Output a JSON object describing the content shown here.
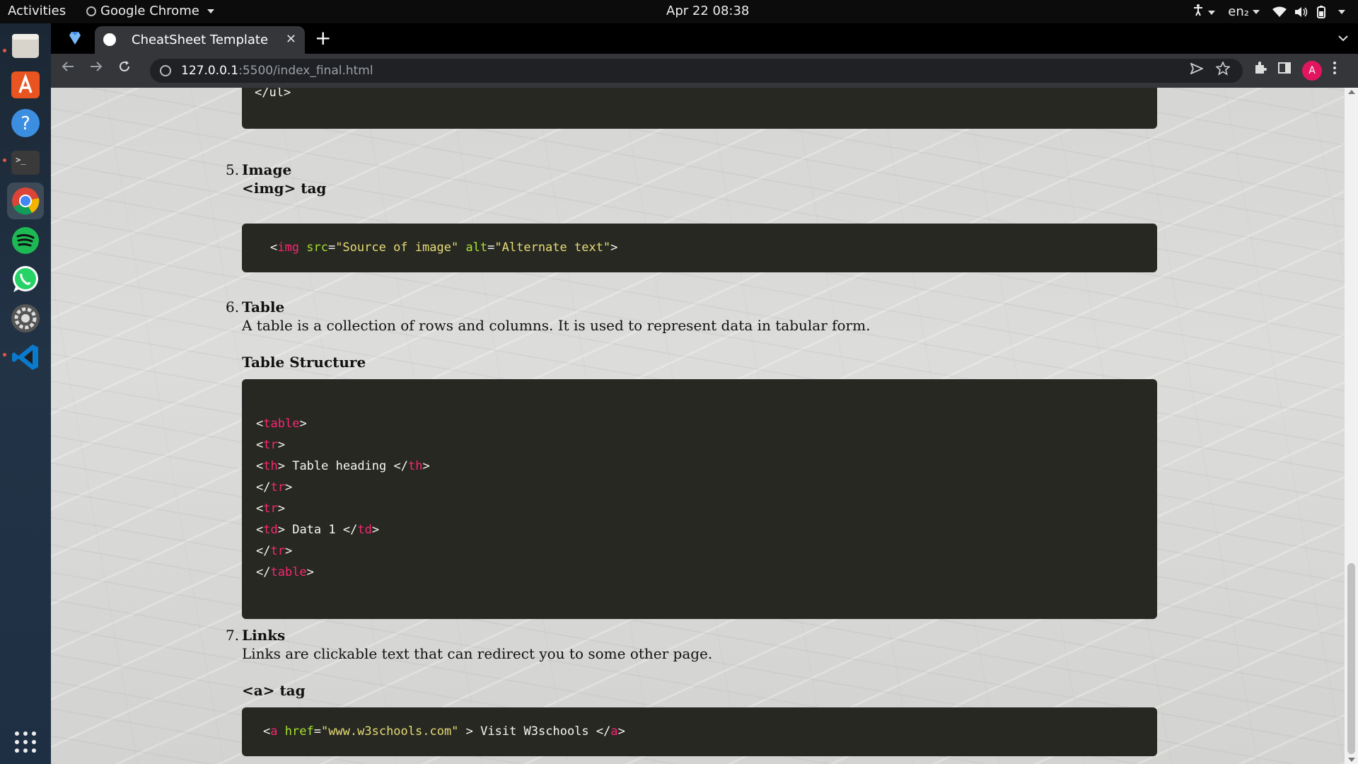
{
  "topbar": {
    "activities": "Activities",
    "app_name": "Google Chrome",
    "clock": "Apr 22  08:38",
    "lang": "en₂"
  },
  "dock": {
    "items": [
      "files-icon",
      "software-icon",
      "help-icon",
      "terminal-icon",
      "chrome-icon",
      "spotify-icon",
      "whatsapp-icon",
      "settings-icon",
      "vscode-icon"
    ],
    "apps_grid": "apps-grid-icon"
  },
  "browser": {
    "tab_title": "CheatSheet Template",
    "close_glyph": "✕",
    "new_tab_glyph": "+",
    "url_host": "127.0.0.1",
    "url_path": ":5500/index_final.html",
    "avatar_letter": "A"
  },
  "page": {
    "prev_code_tail": "</ul>",
    "sections": [
      {
        "num": "5.",
        "title": "Image",
        "subtitle": "<img> tag",
        "code": {
          "open": "<",
          "tag": "img",
          "attr1": "src",
          "eq1": "=",
          "val1": "\"Source of image\"",
          "attr2": "alt",
          "eq2": "=",
          "val2": "\"Alternate text\"",
          "close": ">"
        }
      },
      {
        "num": "6.",
        "title": "Table",
        "text": "A table is a collection of rows and columns. It is used to represent data in tabular form.",
        "subtitle": "Table Structure",
        "code_lines": [
          {
            "pre": "<",
            "tag": "table",
            "mid": "",
            "tag2": "",
            "post": ">"
          },
          {
            "pre": "<",
            "tag": "tr",
            "mid": "",
            "tag2": "",
            "post": ">"
          },
          {
            "pre": "<",
            "tag": "th",
            "mid": "> Table heading </",
            "tag2": "th",
            "post": ">"
          },
          {
            "pre": "</",
            "tag": "tr",
            "mid": "",
            "tag2": "",
            "post": ">"
          },
          {
            "pre": "<",
            "tag": "tr",
            "mid": "",
            "tag2": "",
            "post": ">"
          },
          {
            "pre": "<",
            "tag": "td",
            "mid": "> Data 1 </",
            "tag2": "td",
            "post": ">"
          },
          {
            "pre": "</",
            "tag": "tr",
            "mid": "",
            "tag2": "",
            "post": ">"
          },
          {
            "pre": "</",
            "tag": "table",
            "mid": "",
            "tag2": "",
            "post": ">"
          }
        ]
      },
      {
        "num": "7.",
        "title": "Links",
        "text": "Links are clickable text that can redirect you to some other page.",
        "subtitle": "<a> tag",
        "code": {
          "open": "<",
          "tag": "a",
          "attr1": "href",
          "eq1": "=",
          "val1": "\"www.w3schools.com\"",
          "mid": " > Visit W3schools </",
          "tag2": "a",
          "close": ">"
        }
      }
    ]
  },
  "colors": {
    "code_bg": "#272822",
    "code_tag": "#f92672",
    "code_attr": "#a6e22e",
    "code_string": "#e6db74"
  }
}
